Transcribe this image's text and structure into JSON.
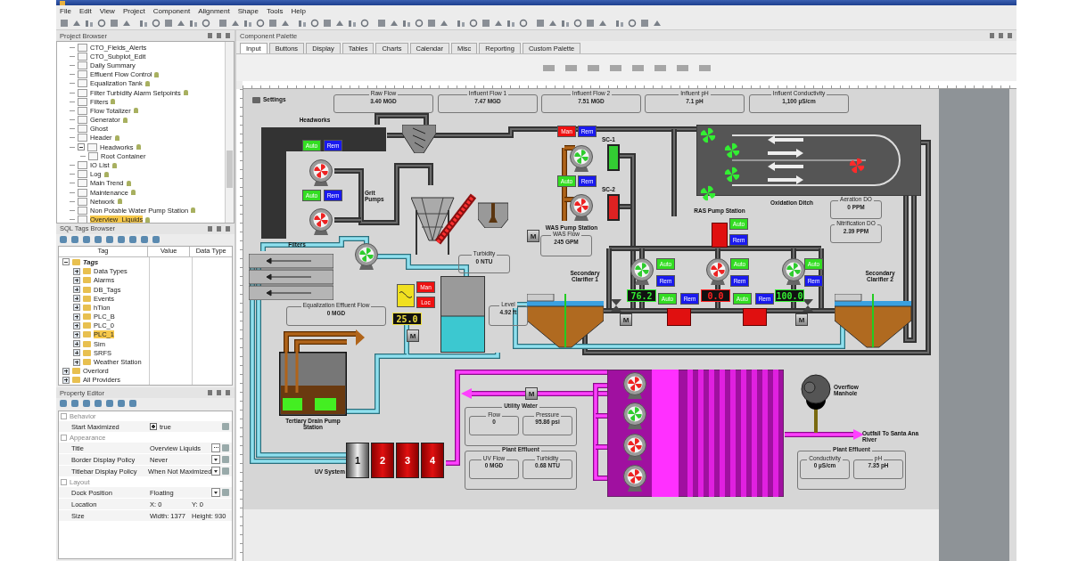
{
  "menu": [
    "File",
    "Edit",
    "View",
    "Project",
    "Component",
    "Alignment",
    "Shape",
    "Tools",
    "Help"
  ],
  "project_browser": {
    "title": "Project Browser",
    "items": [
      {
        "label": "CTO_Fields_Alerts",
        "locked": false,
        "selected": false
      },
      {
        "label": "CTO_Subplot_Edit",
        "locked": false,
        "selected": false
      },
      {
        "label": "Daily Summary",
        "locked": false,
        "selected": false
      },
      {
        "label": "Effluent Flow Control",
        "locked": true,
        "selected": false
      },
      {
        "label": "Equalization Tank",
        "locked": true,
        "selected": false
      },
      {
        "label": "Filter Turbidity Alarm Setpoints",
        "locked": true,
        "selected": false
      },
      {
        "label": "Filters",
        "locked": true,
        "selected": false
      },
      {
        "label": "Flow Totalizer",
        "locked": true,
        "selected": false
      },
      {
        "label": "Generator",
        "locked": true,
        "selected": false
      },
      {
        "label": "Ghost",
        "locked": false,
        "selected": false
      },
      {
        "label": "Header",
        "locked": true,
        "selected": false
      },
      {
        "label": "Headworks",
        "locked": true,
        "selected": false,
        "children": [
          {
            "label": "Root Container",
            "locked": false,
            "selected": false
          }
        ]
      },
      {
        "label": "IO List",
        "locked": true,
        "selected": false
      },
      {
        "label": "Log",
        "locked": true,
        "selected": false
      },
      {
        "label": "Main Trend",
        "locked": true,
        "selected": false
      },
      {
        "label": "Maintenance",
        "locked": true,
        "selected": false
      },
      {
        "label": "Network",
        "locked": true,
        "selected": false
      },
      {
        "label": "Non Potable Water Pump Station",
        "locked": true,
        "selected": false
      },
      {
        "label": "Overview_Liquids",
        "locked": true,
        "selected": true
      }
    ]
  },
  "tags_browser": {
    "title": "SQL Tags Browser",
    "columns": [
      "Tag",
      "Value",
      "Data Type"
    ],
    "tree": [
      {
        "label": "Tags",
        "expanded": true,
        "selected": false,
        "children": [
          {
            "label": "Data Types",
            "expanded": false,
            "selected": false
          },
          {
            "label": "Alarms",
            "expanded": false,
            "selected": false
          },
          {
            "label": "DB_Tags",
            "expanded": false,
            "selected": false
          },
          {
            "label": "Events",
            "expanded": false,
            "selected": false
          },
          {
            "label": "hTion",
            "expanded": false,
            "selected": false
          },
          {
            "label": "PLC_B",
            "expanded": false,
            "selected": false
          },
          {
            "label": "PLC_0",
            "expanded": false,
            "selected": false
          },
          {
            "label": "PLC_1",
            "expanded": false,
            "selected": true
          },
          {
            "label": "Sim",
            "expanded": false,
            "selected": false
          },
          {
            "label": "SRFS",
            "expanded": false,
            "selected": false
          },
          {
            "label": "Weather Station",
            "expanded": false,
            "selected": false
          }
        ]
      },
      {
        "label": "Overlord",
        "expanded": false,
        "selected": false
      },
      {
        "label": "All Providers",
        "expanded": false,
        "selected": false
      }
    ]
  },
  "property_editor": {
    "title": "Property Editor",
    "sections": [
      {
        "label": "Behavior",
        "rows": [
          {
            "name": "Start Maximized",
            "kind": "checkbox",
            "checked": true,
            "value": "true"
          }
        ]
      },
      {
        "label": "Appearance",
        "rows": [
          {
            "name": "Title",
            "kind": "ellipsis",
            "value": "Overview Liquids"
          },
          {
            "name": "Border Display Policy",
            "kind": "dropdown",
            "value": "Never"
          },
          {
            "name": "Titlebar Display Policy",
            "kind": "dropdown",
            "value": "When Not Maximized"
          }
        ]
      },
      {
        "label": "Layout",
        "rows": [
          {
            "name": "Dock Position",
            "kind": "dropdown",
            "value": "Floating"
          },
          {
            "name": "Location",
            "kind": "pair",
            "values": [
              "X: 0",
              "Y: 0"
            ]
          },
          {
            "name": "Size",
            "kind": "pair",
            "values": [
              "Width: 1377",
              "Height: 930"
            ]
          }
        ]
      }
    ]
  },
  "palette": {
    "title": "Component Palette",
    "tabs": [
      {
        "label": "Input",
        "selected": true
      },
      {
        "label": "Buttons",
        "selected": false
      },
      {
        "label": "Display",
        "selected": false
      },
      {
        "label": "Tables",
        "selected": false
      },
      {
        "label": "Charts",
        "selected": false
      },
      {
        "label": "Calendar",
        "selected": false
      },
      {
        "label": "Misc",
        "selected": false
      },
      {
        "label": "Reporting",
        "selected": false
      },
      {
        "label": "Custom Palette",
        "selected": false
      }
    ]
  },
  "canvas": {
    "settings": "Settings",
    "labels": [
      "Headworks",
      "Grit Pumps",
      "Filters",
      "WAS Pump Station",
      "Oxidation Ditch",
      "RAS Pump Station",
      "Secondary Clarifier 1",
      "Secondary Clarifier 2",
      "Tertiary Drain Pump Station",
      "UV System",
      "Overflow Manhole",
      "Outfall To Santa Ana River"
    ],
    "readouts": [
      {
        "label": "Raw Flow",
        "value": "3.40 MGD"
      },
      {
        "label": "Influent Flow 1",
        "value": "7.47 MGD"
      },
      {
        "label": "Influent Flow 2",
        "value": "7.51 MGD"
      },
      {
        "label": "Influent pH",
        "value": "7.1 pH"
      },
      {
        "label": "Influent Conductivity",
        "value": "1,100 µS/cm"
      },
      {
        "label": "Aeration DO",
        "value": "0 PPM"
      },
      {
        "label": "Nitrification DO",
        "value": "2.39 PPM"
      },
      {
        "label": "WAS Flow",
        "value": "245 GPM"
      },
      {
        "label": "Turbidity",
        "value": "0 NTU"
      },
      {
        "label": "Equalization Effluent Flow",
        "value": "0 MGD"
      },
      {
        "label": "Level",
        "value": "4.92 ft"
      }
    ],
    "panels": [
      {
        "title": "Utility Water",
        "readouts": [
          {
            "label": "Flow",
            "value": "0"
          },
          {
            "label": "Pressure",
            "value": "95.86 psi"
          }
        ]
      },
      {
        "title": "Plant Effluent",
        "readouts": [
          {
            "label": "UV Flow",
            "value": "0 MGD"
          },
          {
            "label": "Turbidity",
            "value": "0.68 NTU"
          }
        ]
      },
      {
        "title": "Plant Effluent",
        "readouts": [
          {
            "label": "Conductivity",
            "value": "0 µS/cm"
          },
          {
            "label": "pH",
            "value": "7.35 pH"
          }
        ]
      }
    ],
    "mode_buttons": [
      {
        "label": "Auto",
        "color": "#33dd22"
      },
      {
        "label": "Rem",
        "color": "#1a1aee"
      },
      {
        "label": "Auto",
        "color": "#33dd22"
      },
      {
        "label": "Rem",
        "color": "#1a1aee"
      },
      {
        "label": "Man",
        "color": "#ee1111"
      },
      {
        "label": "Rem",
        "color": "#1a1aee"
      },
      {
        "label": "Auto",
        "color": "#33dd22"
      },
      {
        "label": "Rem",
        "color": "#1a1aee"
      },
      {
        "label": "Man",
        "color": "#ee1111"
      },
      {
        "label": "Loc",
        "color": "#ee1111"
      },
      {
        "label": "Auto",
        "color": "#33dd22"
      },
      {
        "label": "Rem",
        "color": "#1a1aee"
      },
      {
        "label": "Auto",
        "color": "#33dd22"
      },
      {
        "label": "Rem",
        "color": "#1a1aee"
      },
      {
        "label": "Auto",
        "color": "#33dd22"
      },
      {
        "label": "Rem",
        "color": "#1a1aee"
      },
      {
        "label": "Auto",
        "color": "#33dd22"
      },
      {
        "label": "Rem",
        "color": "#1a1aee"
      },
      {
        "label": "Auto",
        "color": "#33dd22"
      },
      {
        "label": "Rem",
        "color": "#1a1aee"
      },
      {
        "label": "Auto",
        "color": "#33dd22"
      },
      {
        "label": "Rem",
        "color": "#1a1aee"
      }
    ],
    "pumps": [
      {
        "running": false
      },
      {
        "running": false
      },
      {
        "running": true
      },
      {
        "running": false
      },
      {
        "running": true
      },
      {
        "running": true
      },
      {
        "running": false
      },
      {
        "running": true
      },
      {
        "running": false
      },
      {
        "running": true
      },
      {
        "running": false
      },
      {
        "running": false
      }
    ],
    "aerators": [
      {
        "running": true
      },
      {
        "running": true
      },
      {
        "running": true
      },
      {
        "running": true
      },
      {
        "running": false
      }
    ],
    "sc_units": [
      {
        "label": "SC-1",
        "color": "#33cc33"
      },
      {
        "label": "SC-2",
        "color": "#dd2222"
      }
    ],
    "displays": [
      {
        "value": "25.0",
        "color": "#f0e040"
      },
      {
        "value": "76.2",
        "color": "#33ee33"
      },
      {
        "value": "0.0",
        "color": "#ff2222"
      },
      {
        "value": "100.0",
        "color": "#33ee33"
      }
    ],
    "motors": [
      "M",
      "M",
      "M",
      "M",
      "M"
    ],
    "uv_cells": [
      {
        "label": "1",
        "on": false
      },
      {
        "label": "2",
        "on": true
      },
      {
        "label": "3",
        "on": true
      },
      {
        "label": "4",
        "on": true
      }
    ]
  }
}
